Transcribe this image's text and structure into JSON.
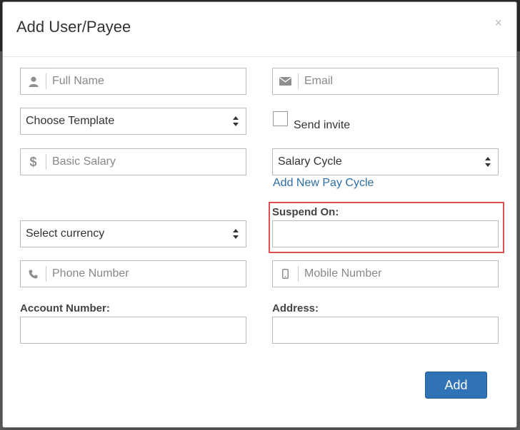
{
  "dialog": {
    "title": "Add User/Payee",
    "close_label": "×"
  },
  "fields": {
    "full_name_placeholder": "Full Name",
    "email_placeholder": "Email",
    "template_value": "Choose Template",
    "send_invite_label": "Send invite",
    "basic_salary_placeholder": "Basic Salary",
    "salary_cycle_value": "Salary Cycle",
    "add_pay_cycle_link": "Add New Pay Cycle",
    "suspend_on_label": "Suspend On:",
    "currency_value": "Select currency",
    "phone_placeholder": "Phone Number",
    "mobile_placeholder": "Mobile Number",
    "account_number_label": "Account Number:",
    "address_label": "Address:"
  },
  "actions": {
    "add_label": "Add"
  },
  "icons": {
    "full_name": "user-icon",
    "email": "envelope-icon",
    "salary": "dollar-icon",
    "phone": "phone-icon",
    "mobile": "mobile-icon"
  },
  "colors": {
    "primary": "#2f73b6",
    "link": "#2e6da4",
    "highlight": "#e05050"
  }
}
